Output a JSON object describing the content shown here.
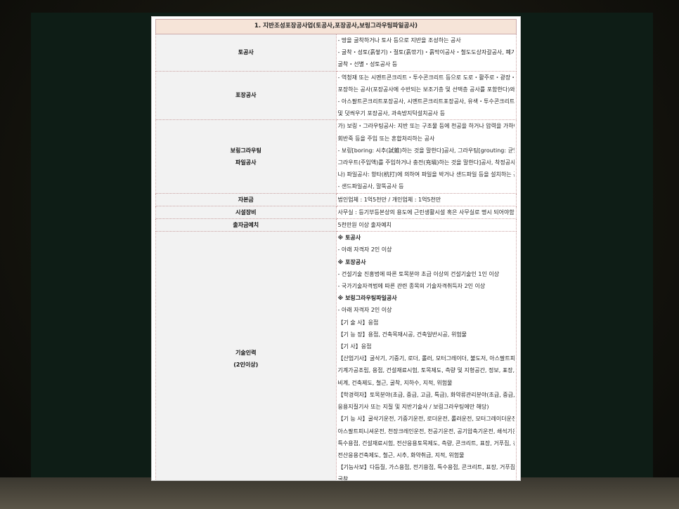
{
  "title": "1. 지반조성포장공사업(토공사,포장공사,보링그라우팅파일공사)",
  "rows": {
    "earthwork": {
      "label": "토공사",
      "lines": [
        "- 땅을 굴착하거나 토사 등으로 지반을 조성하는 공사",
        "- 굴착・성토(흙쌓기)・절토(흙깎기)・흙막이공사・철도도상자갈공사, 폐기물매립지에서의",
        "굴착・선별・성토공사 등"
      ]
    },
    "paving": {
      "label": "포장공사",
      "lines": [
        "- 역청재 또는 시멘트콘크리트・투수콘크리트 등으로 도로・활주로・광장・단지・화물야적장 등을",
        "포장하는 공사(포장공사에 수반되는 보조기층 및 선택층 공사를 포함한다)와 그 유지・수선공사",
        "- 아스팔트콘크리트포장공사, 시멘트콘크리트포장공사, 유색・투수콘크리트포장공사, 소파(小破)보수",
        "및 덧씌우기 포장공사, 과속방지턱설치공사 등"
      ]
    },
    "boring": {
      "label_line1": "보링그라우팅",
      "label_line2": "파일공사",
      "lines": [
        "가) 보링・그라우팅공사: 지반 또는 구조물 등에 천공을 하거나 압력을 가하여 보강재를 설치하거나",
        "회반죽 등을 주입 또는 혼합처리하는 공사",
        "- 보링[boring: 시추(試錐)하는 것을 말한다]공사, 그라우팅[grouting: 균열이나 공동(空洞) 등의 틈새에",
        "그라우트(주입액)를 주입하거나 충전(充塡)하는 것을 말한다]공사, 착정공사, 지열공착정공사 등",
        "나) 파일공사: 항타(杭打)에 의하여 파일을 박거나 샌드파일 등을 설치하는 공사",
        "- 샌드파일공사, 말뚝공사 등"
      ]
    },
    "capital": {
      "label": "자본금",
      "text": "법인업체 : 1억5천만        / 개인업체 : 1억5천만"
    },
    "facility": {
      "label": "시설장비",
      "text": "사무실 : 등기부등본상의 용도에 근린생활시설 혹은 사무실로 명시 되어야함"
    },
    "deposit": {
      "label": "출자금예치",
      "text": "5천만원 이상 출자예치"
    },
    "tech": {
      "label_line1": "기술인력",
      "label_line2": "(2인이상)",
      "lines": [
        "※ 토공사",
        "- 아래 자격자 2인 이상",
        "※ 포장공사",
        "- 건설기술 진흥법에 따른 토목분야 초급 이상의 건설기술인 1인 이상",
        "- 국가기술자격법에 따른 관련 종목의 기술자격취득자 2인 이상",
        "※ 보링그라우팅파일공사",
        "- 아래 자격자 2인 이상",
        "【기 술 사】응접",
        "【기 능 장】용접, 건축목재시공, 건축일반시공, 위험물",
        "【기      사】응접",
        "【산업기사】굴삭기, 기중기, 로더, 롤러, 모터그레이더, 불도저, 아스팔트피니셔, 공기압축기, 쇄석기,",
        "기계가공조립, 용접, 건설재료시험, 토목제도, 측량 및 지형공간, 정보, 표장, 건축목공, 건축일반시공,",
        "비계, 건축제도, 철근, 굴착, 지하수, 지적, 위험물",
        "【학경력자】토목분야(초급, 중급, 고급, 특급), 화약류관리분야(초급, 중급, 고급, 특급 / 토공에만 해당),",
        "응용지질기사 또는 지질 및 지반기술사 / 보링그라우팅에만 해당)",
        "【기 능 사】굴삭기운전, 기중기운전, 로더운전, 롤러운전, 모터그레이더운전, 불도저운전,",
        "아스팔트피니셔운전, 천장크레인운전, 천공기운전, 공기압축기운전, 쇄석기운전, 기계가공조립, 용접,",
        "특수용접, 건설재료시험, 전산응용토목제도, 측량, 콘크리트, 표장, 거푸집, 건축목공, 비계,",
        "전산응용건축제도, 철근, 시추, 화약취급, 지적, 위험물",
        "【기능사보】다듬질, 가스용접, 전기용접, 특수용접, 콘크리트, 표장, 거푸집, 건축목공, 비계, 철근, 시추,",
        "굴착"
      ]
    }
  }
}
